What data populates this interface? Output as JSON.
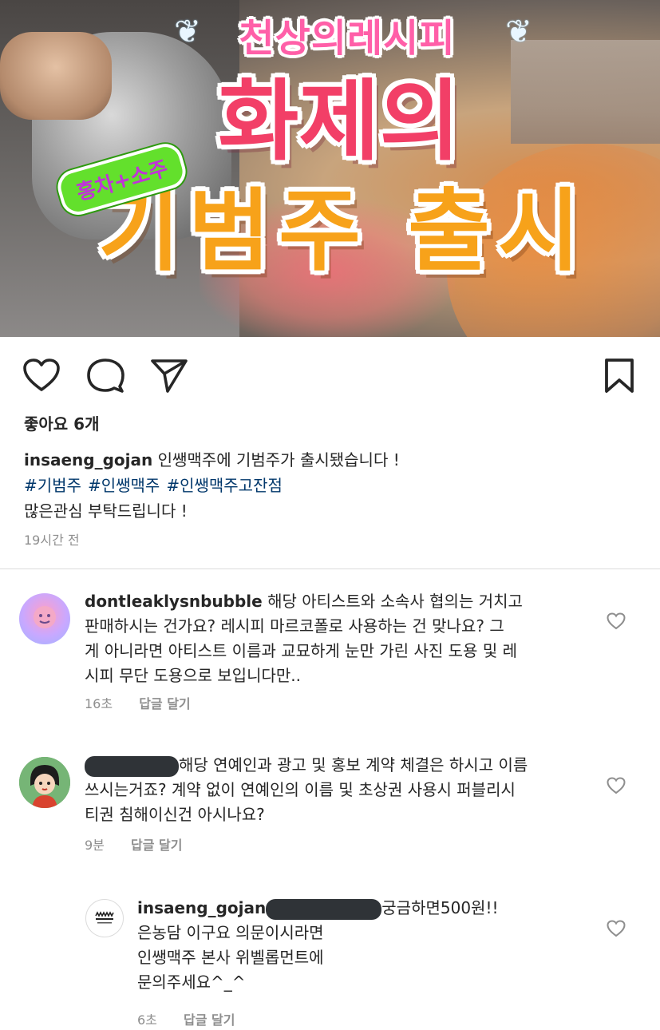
{
  "post_image": {
    "top_title": "천상의레시피",
    "main_title_line1": "화제의",
    "main_title_line2": "기범주 출시",
    "badge": "홍차+소주"
  },
  "actions": {
    "like_icon": "heart-icon",
    "comment_icon": "comment-icon",
    "share_icon": "send-icon",
    "save_icon": "bookmark-icon"
  },
  "likes": "좋아요 6개",
  "caption": {
    "username": "insaeng_gojan",
    "text": "인쌩맥주에 기범주가 출시됐습니다 !",
    "hashtags": [
      "#기범주",
      "#인쌩맥주",
      "#인쌩맥주고잔점"
    ],
    "line3": "많은관심 부탁드립니다 !",
    "time": "19시간 전"
  },
  "comments": [
    {
      "username": "dontleaklysnbubble",
      "text": "해당 아티스트와 소속사 협의는 거치고",
      "lines": [
        "판매하시는 건가요? 레시피 마르코폴로 사용하는 건 맞나요? 그",
        "게 아니라면 아티스트 이름과 교묘하게 눈만 가린 사진 도용 및 레",
        "시피 무단 도용으로 보입니다만.."
      ],
      "time": "16초",
      "reply": "답글 달기"
    },
    {
      "username": "",
      "text": "해당 연예인과 광고 및 홍보 계약 체결은 하시고 이름",
      "lines": [
        "쓰시는거죠? 계약 없이 연예인의 이름 및 초상권 사용시 퍼블리시",
        "티권 침해이신건 아시나요?"
      ],
      "time": "9분",
      "reply": "답글 달기"
    },
    {
      "username": "insaeng_gojan",
      "text": "궁금하면500원!!",
      "lines": [
        "은농담 이구요 의문이시라면",
        "인쌩맥주 본사 위벨롭먼트에",
        "문의주세요^_^"
      ],
      "time": "6초",
      "reply": "답글 달기"
    }
  ]
}
